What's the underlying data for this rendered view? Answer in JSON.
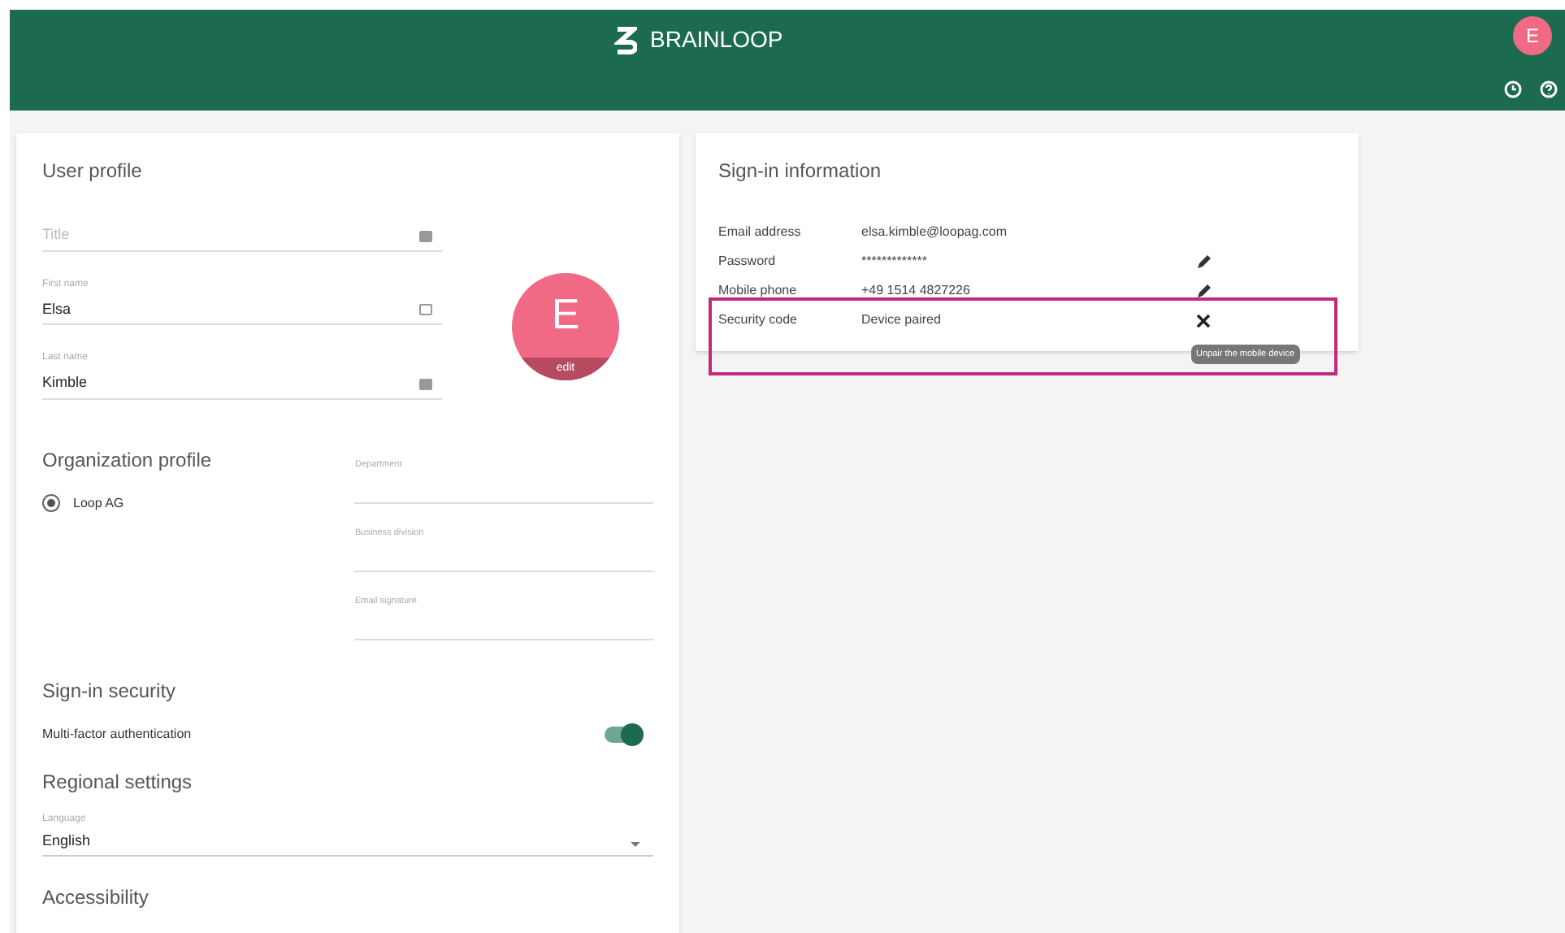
{
  "header": {
    "brand": "BRAINLOOP",
    "avatar_initial": "E"
  },
  "user_profile": {
    "title": "User profile",
    "fields": [
      {
        "placeholder": "Title"
      },
      {
        "label": "First name",
        "value": "Elsa"
      },
      {
        "label": "Last name",
        "value": "Kimble"
      }
    ],
    "avatar": {
      "initial": "E",
      "edit": "edit"
    }
  },
  "organization_profile": {
    "title": "Organization profile",
    "organizations": [
      {
        "name": "Loop AG",
        "selected": true
      }
    ],
    "fields": [
      {
        "label": "Department"
      },
      {
        "label": "Business division"
      },
      {
        "label": "Email signature"
      }
    ]
  },
  "sign_in_security": {
    "title": "Sign-in security",
    "mfa_label": "Multi-factor authentication",
    "mfa_on": true
  },
  "regional_settings": {
    "title": "Regional settings",
    "language_label": "Language",
    "language": "English"
  },
  "accessibility": {
    "title": "Accessibility"
  },
  "sign_in_information": {
    "title": "Sign-in information",
    "rows": [
      {
        "label": "Email address",
        "value": "elsa.kimble@loopag.com",
        "kind": "plain",
        "highlighted": false
      },
      {
        "label": "Password",
        "value": "*************",
        "kind": "editable",
        "highlighted": false
      },
      {
        "label": "Mobile phone",
        "value": "+49 1514 4827226",
        "kind": "editable",
        "highlighted": false
      },
      {
        "label": "Security code",
        "value": "Device paired",
        "kind": "removable",
        "highlighted": true
      }
    ],
    "tooltip": "Unpair the mobile device"
  }
}
